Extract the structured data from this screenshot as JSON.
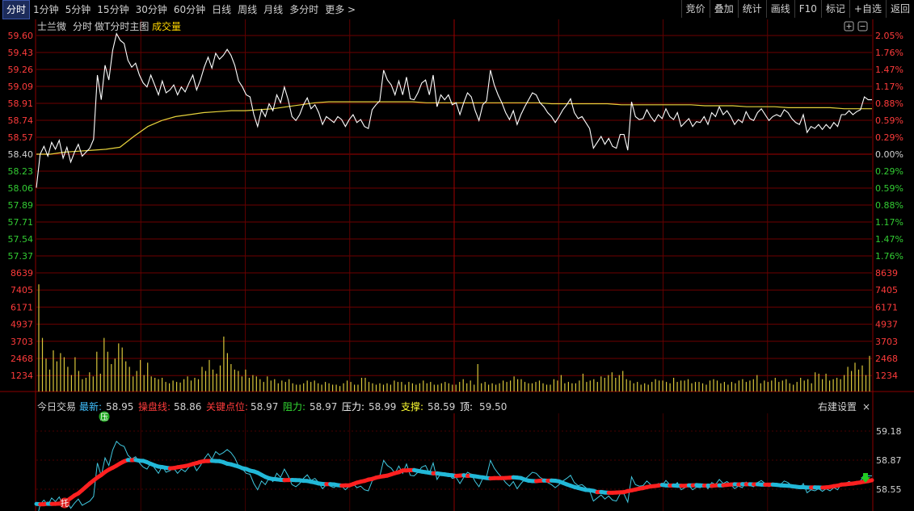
{
  "toolbar": {
    "tabs": [
      "分时",
      "1分钟",
      "5分钟",
      "15分钟",
      "30分钟",
      "60分钟",
      "日线",
      "周线",
      "月线",
      "多分时",
      "更多 >"
    ],
    "active_tab": "分时",
    "right_buttons": [
      "竞价",
      "叠加",
      "统计",
      "画线",
      "F10",
      "标记",
      "+自选",
      "返回"
    ]
  },
  "header": {
    "stock_name": "士兰微",
    "mode": "分时",
    "subchart": "做T分时主图",
    "volume_label": "成交量"
  },
  "price_panel": {
    "left_ticks": [
      "59.60",
      "59.43",
      "59.26",
      "59.09",
      "58.91",
      "58.74",
      "58.57",
      "58.40",
      "58.23",
      "58.06",
      "57.89",
      "57.71",
      "57.54",
      "57.37"
    ],
    "right_ticks": [
      "2.05%",
      "1.76%",
      "1.47%",
      "1.17%",
      "0.88%",
      "0.59%",
      "0.29%",
      "0.00%",
      "0.29%",
      "0.59%",
      "0.88%",
      "1.17%",
      "1.47%",
      "1.76%"
    ]
  },
  "volume_panel": {
    "ticks": [
      "8639",
      "7405",
      "6171",
      "4937",
      "3703",
      "2468",
      "1234"
    ]
  },
  "indicator_panel": {
    "title": "今日交易",
    "items": [
      {
        "label": "最新:",
        "value": "58.95",
        "color": "#40c0ff"
      },
      {
        "label": "操盘线:",
        "value": "58.86",
        "color": "#ff3b3b"
      },
      {
        "label": "关键点位:",
        "value": "58.97",
        "color": "#ff3b3b"
      },
      {
        "label": "阻力:",
        "value": "58.97",
        "color": "#33dd33"
      },
      {
        "label": "压力:",
        "value": "58.99",
        "color": "#ffffff"
      },
      {
        "label": "支撑:",
        "value": "58.59",
        "color": "#ffff33"
      },
      {
        "label": "顶:",
        "value": "59.50",
        "color": "#ffffff"
      }
    ],
    "settings": "右建设置",
    "close": "×",
    "right_ticks": [
      "59.18",
      "58.87",
      "58.55"
    ],
    "marker_press": "压",
    "marker_support": "托"
  },
  "chart_data": {
    "type": "line",
    "price": {
      "ylim": [
        57.2,
        59.6
      ],
      "prev_close": 58.4,
      "x_minutes": [
        0,
        240
      ],
      "price_series": [
        58.06,
        58.4,
        58.48,
        58.38,
        58.52,
        58.45,
        58.54,
        58.36,
        58.47,
        58.32,
        58.42,
        58.5,
        58.38,
        58.42,
        58.46,
        58.55,
        59.2,
        58.95,
        59.3,
        59.15,
        59.45,
        59.62,
        59.55,
        59.52,
        59.35,
        59.28,
        59.32,
        59.2,
        59.12,
        59.08,
        59.2,
        59.1,
        59.0,
        59.14,
        59.02,
        59.05,
        59.1,
        59.0,
        59.08,
        59.03,
        59.12,
        59.2,
        59.05,
        59.15,
        59.28,
        59.38,
        59.27,
        59.42,
        59.36,
        59.4,
        59.46,
        59.4,
        59.3,
        59.14,
        59.08,
        59.0,
        58.98,
        58.8,
        58.68,
        58.85,
        58.78,
        58.91,
        58.84,
        59.0,
        58.92,
        59.08,
        58.95,
        58.78,
        58.74,
        58.8,
        58.9,
        58.97,
        58.86,
        58.9,
        58.82,
        58.7,
        58.78,
        58.75,
        58.72,
        58.78,
        58.75,
        58.68,
        58.75,
        58.8,
        58.72,
        58.75,
        58.68,
        58.66,
        58.85,
        58.9,
        58.94,
        59.25,
        59.15,
        59.1,
        59.0,
        59.14,
        59.0,
        59.18,
        58.96,
        58.95,
        59.02,
        59.12,
        59.15,
        59.0,
        59.2,
        58.88,
        59.0,
        58.95,
        59.0,
        58.9,
        58.92,
        58.8,
        58.92,
        59.02,
        58.98,
        58.84,
        58.74,
        58.9,
        58.94,
        59.25,
        59.1,
        59.0,
        58.92,
        58.82,
        58.75,
        58.84,
        58.7,
        58.8,
        58.88,
        58.95,
        59.02,
        59.0,
        58.92,
        58.88,
        58.82,
        58.78,
        58.72,
        58.78,
        58.85,
        58.9,
        58.96,
        58.82,
        58.76,
        58.78,
        58.72,
        58.66,
        58.46,
        58.52,
        58.58,
        58.5,
        58.56,
        58.48,
        58.46,
        58.6,
        58.6,
        58.44,
        58.93,
        58.78,
        58.75,
        58.76,
        58.85,
        58.78,
        58.73,
        58.8,
        58.76,
        58.86,
        58.78,
        58.75,
        58.82,
        58.68,
        58.72,
        58.76,
        58.68,
        58.73,
        58.72,
        58.78,
        58.7,
        58.82,
        58.78,
        58.88,
        58.8,
        58.84,
        58.78,
        58.7,
        58.75,
        58.72,
        58.83,
        58.76,
        58.74,
        58.82,
        58.86,
        58.8,
        58.74,
        58.78,
        58.8,
        58.78,
        58.85,
        58.82,
        58.76,
        58.72,
        58.7,
        58.8,
        58.62,
        58.68,
        58.66,
        58.7,
        58.65,
        58.7,
        58.66,
        58.72,
        58.68,
        58.8,
        58.8,
        58.84,
        58.8,
        58.83,
        58.85,
        58.98,
        58.95,
        58.95
      ],
      "avg_series": [
        58.4,
        58.4,
        58.42,
        58.43,
        58.44,
        58.45,
        58.47,
        58.58,
        58.68,
        58.74,
        58.78,
        58.8,
        58.82,
        58.83,
        58.84,
        58.84,
        58.85,
        58.86,
        58.88,
        58.9,
        58.92,
        58.93,
        58.93,
        58.93,
        58.93,
        58.93,
        58.93,
        58.93,
        58.92,
        58.92,
        58.92,
        58.92,
        58.92,
        58.92,
        58.92,
        58.92,
        58.92,
        58.91,
        58.91,
        58.91,
        58.91,
        58.91,
        58.9,
        58.9,
        58.9,
        58.9,
        58.9,
        58.9,
        58.89,
        58.89,
        58.89,
        58.88,
        58.88,
        58.88,
        58.87,
        58.87,
        58.87,
        58.87,
        58.86,
        58.86,
        58.86
      ]
    },
    "volume": {
      "ylim": [
        0,
        8639
      ],
      "values": [
        7800,
        3900,
        2400,
        1600,
        3000,
        2200,
        2800,
        2500,
        1800,
        1200,
        2500,
        1500,
        900,
        1000,
        1400,
        1100,
        2900,
        1300,
        3900,
        2900,
        2000,
        2400,
        3500,
        3200,
        2200,
        1800,
        1100,
        1500,
        2300,
        1200,
        2100,
        1100,
        1000,
        900,
        1000,
        700,
        600,
        800,
        700,
        650,
        900,
        1100,
        800,
        1000,
        900,
        1800,
        1500,
        2300,
        1600,
        1300,
        1900,
        4000,
        2800,
        2000,
        1600,
        1500,
        1100,
        1600,
        1000,
        1200,
        1100,
        900,
        700,
        1100,
        800,
        900,
        600,
        800,
        700,
        900,
        600,
        500,
        500,
        600,
        800,
        700,
        800,
        600,
        500,
        700,
        600,
        500,
        500,
        400,
        600,
        800,
        700,
        500,
        500,
        1000,
        1000,
        700,
        600,
        500,
        600,
        500,
        600,
        500,
        800,
        700,
        700,
        500,
        700,
        600,
        500,
        600,
        800,
        600,
        700,
        500,
        500,
        600,
        700,
        600,
        500,
        500,
        700,
        900,
        600,
        800,
        500,
        2000,
        600,
        700,
        500,
        600,
        500,
        600,
        800,
        700,
        800,
        1100,
        900,
        900,
        700,
        600,
        600,
        700,
        800,
        600,
        500,
        500,
        900,
        800,
        1200,
        600,
        700,
        600,
        600,
        800,
        1300,
        700,
        800,
        900,
        700,
        1100,
        1000,
        1200,
        1400,
        1000,
        1200,
        1500,
        900,
        800,
        600,
        700,
        500,
        600,
        500,
        700,
        900,
        800,
        800,
        700,
        600,
        1000,
        700,
        800,
        800,
        900,
        600,
        700,
        700,
        600,
        500,
        800,
        900,
        800,
        600,
        700,
        500,
        700,
        600,
        800,
        900,
        700,
        800,
        900,
        1200,
        600,
        800,
        700,
        800,
        1000,
        700,
        800,
        900,
        600,
        500,
        700,
        1000,
        800,
        900,
        600,
        1400,
        1300,
        900,
        1300,
        800,
        900,
        1000,
        900,
        1200,
        1800,
        1500,
        2100,
        1600,
        1900,
        1200,
        2600
      ]
    }
  }
}
